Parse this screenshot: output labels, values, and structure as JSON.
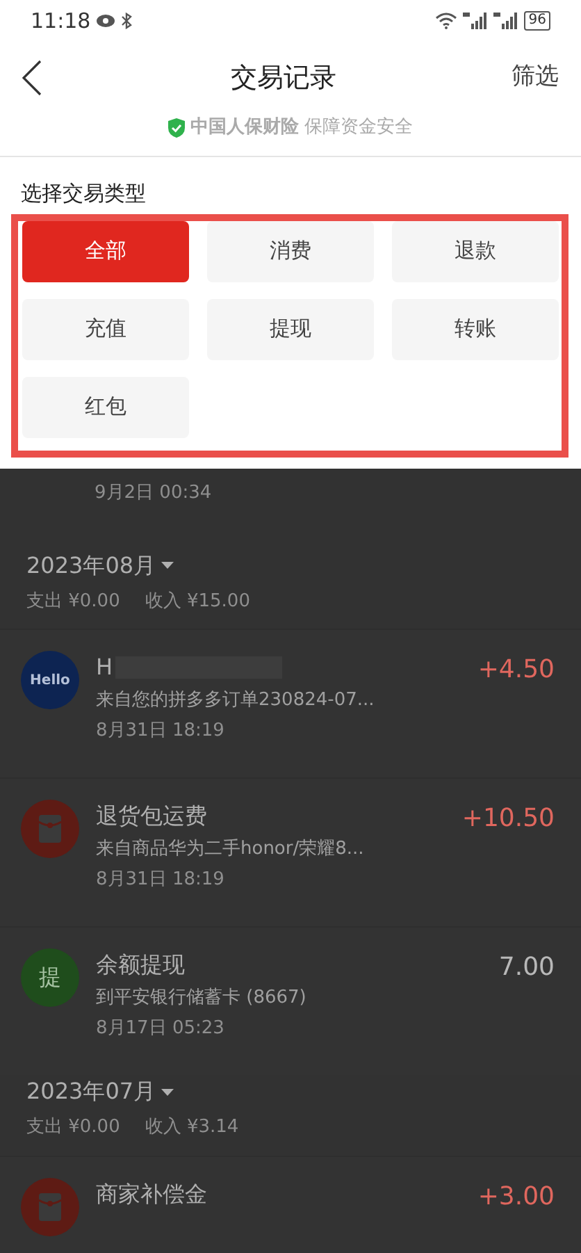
{
  "status_bar": {
    "time": "11:18",
    "battery": "96"
  },
  "header": {
    "title": "交易记录",
    "action": "筛选",
    "insurer": "中国人保财险",
    "guarantee": "保障资金安全"
  },
  "filter": {
    "title": "选择交易类型",
    "types": [
      {
        "label": "全部",
        "selected": true
      },
      {
        "label": "消费",
        "selected": false
      },
      {
        "label": "退款",
        "selected": false
      },
      {
        "label": "充值",
        "selected": false
      },
      {
        "label": "提现",
        "selected": false
      },
      {
        "label": "转账",
        "selected": false
      },
      {
        "label": "红包",
        "selected": false
      }
    ]
  },
  "partial_time": "9月2日 00:34",
  "months": [
    {
      "title": "2023年08月",
      "expense": "支出 ¥0.00",
      "income": "收入 ¥15.00",
      "items": [
        {
          "kind": "hello",
          "icon_text": "Hello",
          "title": "H",
          "subtitle": "来自您的拼多多订单230824-07...",
          "time": "8月31日 18:19",
          "amount": "+4.50",
          "income": true
        },
        {
          "kind": "envelope",
          "title": "退货包运费",
          "subtitle": "来自商品华为二手honor/荣耀8...",
          "time": "8月31日 18:19",
          "amount": "+10.50",
          "income": true
        },
        {
          "kind": "withdraw",
          "icon_text": "提",
          "title": "余额提现",
          "subtitle": "到平安银行储蓄卡 (8667)",
          "time": "8月17日 05:23",
          "amount": "7.00",
          "income": false
        }
      ]
    },
    {
      "title": "2023年07月",
      "expense": "支出 ¥0.00",
      "income": "收入 ¥3.14",
      "items": [
        {
          "kind": "envelope",
          "title": "商家补偿金",
          "amount": "+3.00",
          "income": true
        }
      ]
    }
  ]
}
